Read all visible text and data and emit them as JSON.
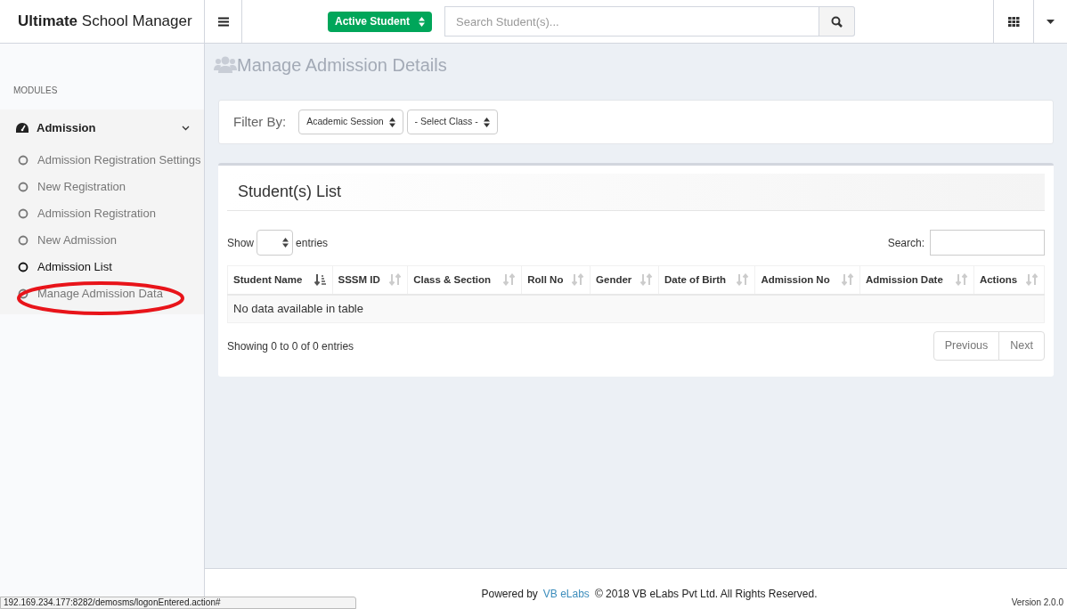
{
  "header": {
    "brand_bold": "Ultimate",
    "brand_rest": "School Manager",
    "status_select": "Active Student",
    "search": {
      "placeholder": "Search Student(s)..."
    }
  },
  "sidebar": {
    "section": "MODULES",
    "group": {
      "label": "Admission",
      "expanded": true,
      "items": [
        {
          "label": "Admission Registration Settings",
          "selected": false
        },
        {
          "label": "New Registration",
          "selected": false
        },
        {
          "label": "Admission Registration",
          "selected": false
        },
        {
          "label": "New Admission",
          "selected": false
        },
        {
          "label": "Admission List",
          "selected": true
        },
        {
          "label": "Manage Admission Data",
          "selected": false
        }
      ]
    }
  },
  "page_title": "Manage Admission Details",
  "filter": {
    "label": "Filter By:",
    "selects": [
      "Academic Session",
      "- Select Class -"
    ]
  },
  "list": {
    "title": "Student(s) List",
    "show_label": "Show",
    "entries_label": "entries",
    "search_label": "Search:",
    "columns": [
      {
        "label": "Student Name",
        "sorted": true
      },
      {
        "label": "SSSM ID",
        "sorted": false
      },
      {
        "label": "Class & Section",
        "sorted": false
      },
      {
        "label": "Roll No",
        "sorted": false
      },
      {
        "label": "Gender",
        "sorted": false
      },
      {
        "label": "Date of Birth",
        "sorted": false
      },
      {
        "label": "Admission No",
        "sorted": false
      },
      {
        "label": "Admission Date",
        "sorted": false
      },
      {
        "label": "Actions",
        "sorted": false
      }
    ],
    "empty": "No data available in table",
    "info": "Showing 0 to 0 of 0 entries",
    "pager": [
      {
        "label": "Previous",
        "disabled": true
      },
      {
        "label": "Next",
        "disabled": true
      }
    ]
  },
  "footer": {
    "powered": "Powered by",
    "link": "VB eLabs",
    "copyright": "© 2018 VB eLabs Pvt Ltd. All Rights Reserved.",
    "version": "Version 2.0.0"
  },
  "status_url": "192.169.234.177:8282/demosms/logonEntered.action#",
  "annotation": {
    "kind": "ellipse"
  }
}
